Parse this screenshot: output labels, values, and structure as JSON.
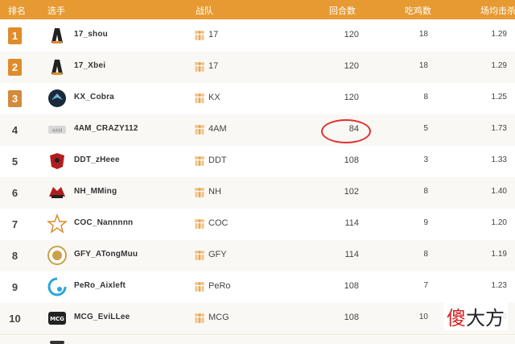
{
  "header": {
    "rank": "排名",
    "player": "选手",
    "team": "战队",
    "rounds": "回合数",
    "chicken": "吃鸡数",
    "kpr": "场均击杀"
  },
  "rows": [
    {
      "rank": "1",
      "player": "17_shou",
      "team": "17",
      "rounds": "120",
      "chicken": "18",
      "kpr": "1.29",
      "medal": "gold"
    },
    {
      "rank": "2",
      "player": "17_Xbei",
      "team": "17",
      "rounds": "120",
      "chicken": "18",
      "kpr": "1.29",
      "medal": "gold"
    },
    {
      "rank": "3",
      "player": "KX_Cobra",
      "team": "KX",
      "rounds": "120",
      "chicken": "8",
      "kpr": "1.25",
      "medal": "bronze"
    },
    {
      "rank": "4",
      "player": "4AM_CRAZY112",
      "team": "4AM",
      "rounds": "84",
      "chicken": "5",
      "kpr": "1.73"
    },
    {
      "rank": "5",
      "player": "DDT_zHeee",
      "team": "DDT",
      "rounds": "108",
      "chicken": "3",
      "kpr": "1.33"
    },
    {
      "rank": "6",
      "player": "NH_MMing",
      "team": "NH",
      "rounds": "102",
      "chicken": "8",
      "kpr": "1.40"
    },
    {
      "rank": "7",
      "player": "COC_Nannnnn",
      "team": "COC",
      "rounds": "114",
      "chicken": "9",
      "kpr": "1.20"
    },
    {
      "rank": "8",
      "player": "GFY_ATongMuu",
      "team": "GFY",
      "rounds": "114",
      "chicken": "8",
      "kpr": "1.19"
    },
    {
      "rank": "9",
      "player": "PeRo_Aixleft",
      "team": "PeRo",
      "rounds": "108",
      "chicken": "7",
      "kpr": "1.23"
    },
    {
      "rank": "10",
      "player": "MCG_EviLLee",
      "team": "MCG",
      "rounds": "108",
      "chicken": "10",
      "kpr": "1.18"
    }
  ],
  "watermark": {
    "part1": "傻",
    "part2": "大方"
  },
  "colors": {
    "header_bg": "#e79a32",
    "medal": "#e08b2a",
    "highlight_circle": "#e03030"
  }
}
